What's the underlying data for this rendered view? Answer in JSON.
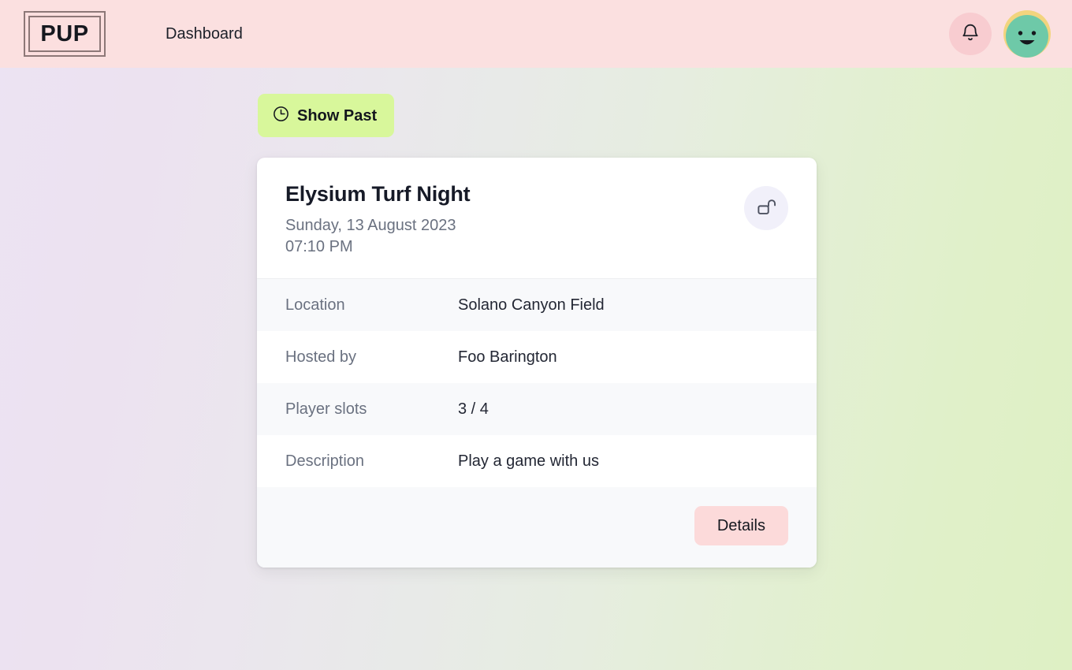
{
  "header": {
    "logo_text": "PUP",
    "logo_icon": "pup-logo-box",
    "nav_items": [
      {
        "label": "Dashboard"
      }
    ],
    "notification_icon": "bell-icon",
    "avatar_icon": "user-avatar-face"
  },
  "toolbar": {
    "show_past_label": "Show Past",
    "show_past_icon": "clock-icon"
  },
  "card": {
    "title": "Elysium Turf Night",
    "date": "Sunday, 13 August 2023",
    "time": "07:10 PM",
    "lock_icon": "unlocked-padlock-icon",
    "details": [
      {
        "label": "Location",
        "value": "Solano Canyon Field"
      },
      {
        "label": "Hosted by",
        "value": "Foo Barington"
      },
      {
        "label": "Player slots",
        "value": "3 / 4"
      },
      {
        "label": "Description",
        "value": "Play a game with us"
      }
    ],
    "details_button_label": "Details"
  },
  "colors": {
    "header_bg": "#fbe0e0",
    "show_past_bg": "#d8f79b",
    "details_bg": "#fcdada",
    "lock_badge_bg": "#f1f0fa",
    "bell_circle_bg": "#f8ccd0",
    "avatar_face": "#6ec9a8",
    "avatar_hair": "#f2d47e",
    "card_bg": "#ffffff",
    "row_striped_bg": "#f8f9fb"
  }
}
